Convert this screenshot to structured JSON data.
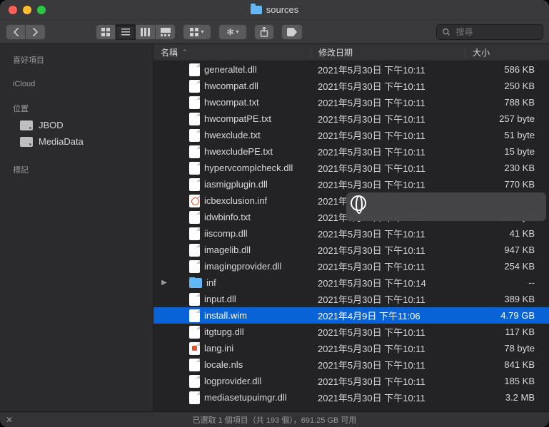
{
  "window_title": "sources",
  "search_placeholder": "搜尋",
  "columns": {
    "name": "名稱",
    "date": "修改日期",
    "size": "大小"
  },
  "sidebar": {
    "favorites_label": "喜好項目",
    "icloud_label": "iCloud",
    "locations_label": "位置",
    "locations": [
      {
        "label": "JBOD"
      },
      {
        "label": "MediaData"
      }
    ],
    "tags_label": "標記"
  },
  "files": [
    {
      "name": "generaltel.dll",
      "date": "2021年5月30日 下午10:11",
      "size": "586 KB",
      "type": "file"
    },
    {
      "name": "hwcompat.dll",
      "date": "2021年5月30日 下午10:11",
      "size": "250 KB",
      "type": "file"
    },
    {
      "name": "hwcompat.txt",
      "date": "2021年5月30日 下午10:11",
      "size": "788 KB",
      "type": "file"
    },
    {
      "name": "hwcompatPE.txt",
      "date": "2021年5月30日 下午10:11",
      "size": "257 byte",
      "type": "file"
    },
    {
      "name": "hwexclude.txt",
      "date": "2021年5月30日 下午10:11",
      "size": "51 byte",
      "type": "file"
    },
    {
      "name": "hwexcludePE.txt",
      "date": "2021年5月30日 下午10:11",
      "size": "15 byte",
      "type": "file"
    },
    {
      "name": "hypervcomplcheck.dll",
      "date": "2021年5月30日 下午10:11",
      "size": "230 KB",
      "type": "file"
    },
    {
      "name": "iasmigplugin.dll",
      "date": "2021年5月30日 下午10:11",
      "size": "770 KB",
      "type": "file"
    },
    {
      "name": "icbexclusion.inf",
      "date": "2021年",
      "size": "",
      "type": "inf",
      "obscured": true
    },
    {
      "name": "idwbinfo.txt",
      "date": "2021年5月30日 下午10:11",
      "size": "122 byte",
      "type": "file",
      "obscured": true
    },
    {
      "name": "iiscomp.dll",
      "date": "2021年5月30日 下午10:11",
      "size": "41 KB",
      "type": "file"
    },
    {
      "name": "imagelib.dll",
      "date": "2021年5月30日 下午10:11",
      "size": "947 KB",
      "type": "file"
    },
    {
      "name": "imagingprovider.dll",
      "date": "2021年5月30日 下午10:11",
      "size": "254 KB",
      "type": "file"
    },
    {
      "name": "inf",
      "date": "2021年5月30日 下午10:14",
      "size": "--",
      "type": "folder"
    },
    {
      "name": "input.dll",
      "date": "2021年5月30日 下午10:11",
      "size": "389 KB",
      "type": "file"
    },
    {
      "name": "install.wim",
      "date": "2021年4月9日 下午11:06",
      "size": "4.79 GB",
      "type": "file",
      "selected": true
    },
    {
      "name": "itgtupg.dll",
      "date": "2021年5月30日 下午10:11",
      "size": "117 KB",
      "type": "file"
    },
    {
      "name": "lang.ini",
      "date": "2021年5月30日 下午10:11",
      "size": "78 byte",
      "type": "ini"
    },
    {
      "name": "locale.nls",
      "date": "2021年5月30日 下午10:11",
      "size": "841 KB",
      "type": "file"
    },
    {
      "name": "logprovider.dll",
      "date": "2021年5月30日 下午10:11",
      "size": "185 KB",
      "type": "file"
    },
    {
      "name": "mediasetupuimgr.dll",
      "date": "2021年5月30日 下午10:11",
      "size": "3.2 MB",
      "type": "file"
    }
  ],
  "status": {
    "text": "已選取 1 個項目（共 193 個），691.25 GB 可用"
  }
}
